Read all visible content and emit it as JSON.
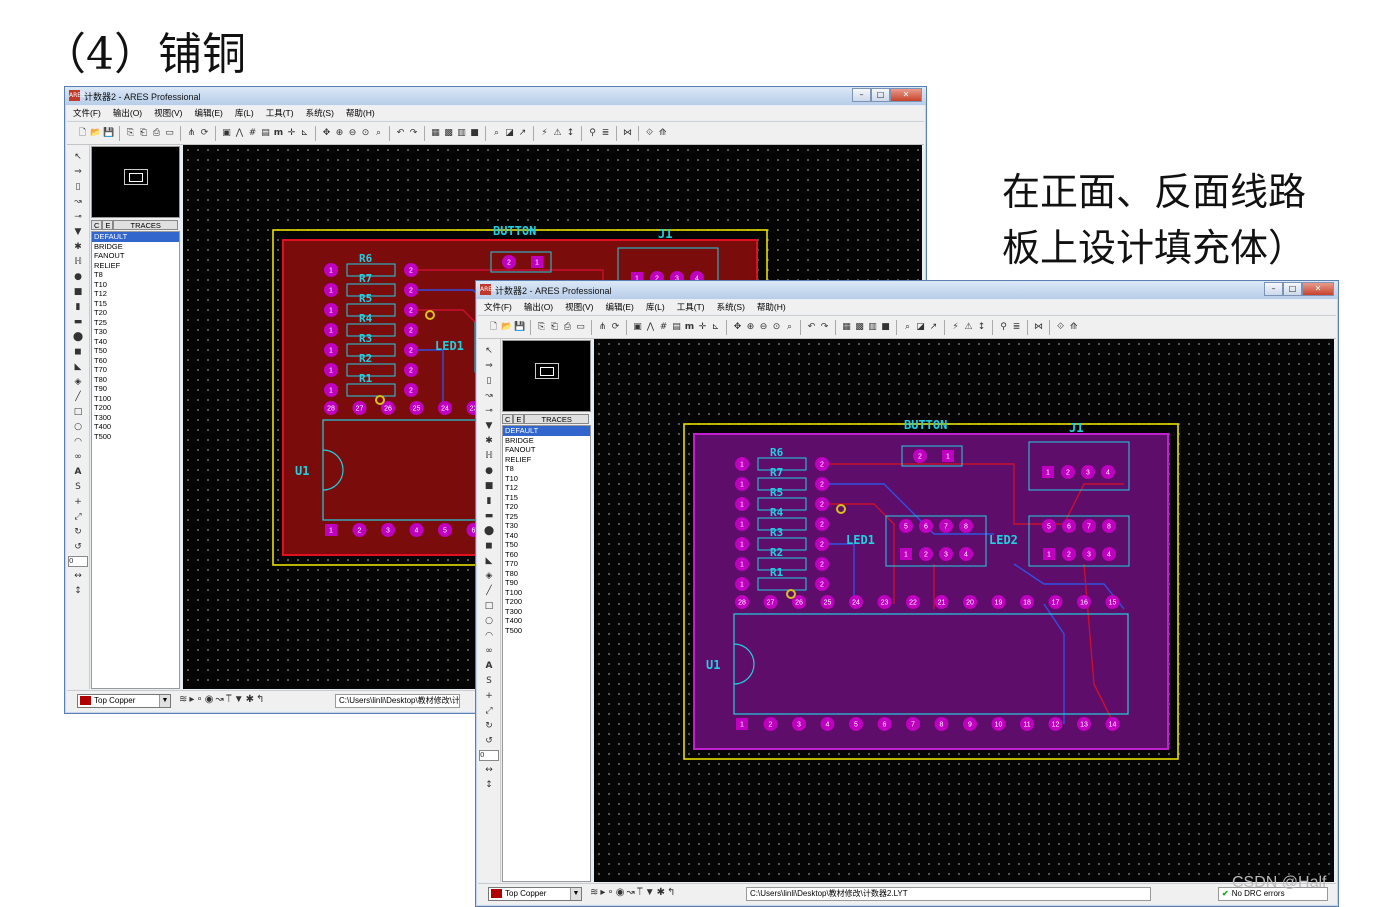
{
  "slide": {
    "heading": "（4）铺铜",
    "caption_line1": "在正面、反面线路",
    "caption_line2": "板上设计填充体）",
    "watermark": "CSDN @Half"
  },
  "window": {
    "title": "计数器2 - ARES Professional",
    "logo": "ARES",
    "controls": {
      "minimize": "–",
      "maximize": "□",
      "close": "✕"
    },
    "menu": [
      "文件(F)",
      "输出(O)",
      "视图(V)",
      "编辑(E)",
      "库(L)",
      "工具(T)",
      "系统(S)",
      "帮助(H)"
    ],
    "panel_tabs": {
      "c": "C",
      "e": "E",
      "traces": "TRACES"
    },
    "trace_styles": [
      "DEFAULT",
      "BRIDGE",
      "FANOUT",
      "RELIEF",
      "T8",
      "T10",
      "T12",
      "T15",
      "T20",
      "T25",
      "T30",
      "T40",
      "T50",
      "T60",
      "T70",
      "T80",
      "T90",
      "T100",
      "T200",
      "T300",
      "T400",
      "T500"
    ],
    "selected_style": "DEFAULT",
    "rotation_value": "0",
    "layer": "Top Copper",
    "file_path": "C:\\Users\\linli\\Desktop\\教材修改\\计数器2.LYT",
    "file_path_truncated": "C:\\Users\\linli\\Desktop\\教材修改\\计",
    "drc": "No DRC errors",
    "drc_icon": "check-icon"
  },
  "pcb": {
    "labels": {
      "button": "BUTTON",
      "j1": "J1",
      "led1": "LED1",
      "led2": "LED2",
      "u1": "U1"
    },
    "resistors": [
      "R6",
      "R7",
      "R5",
      "R4",
      "R3",
      "R2",
      "R1"
    ],
    "front_fill_color": "#7a0c0c",
    "back_fill_color": "#5e0e6a",
    "board_outline_color": "#e8e000",
    "top_copper_color": "#c8102e",
    "bottom_copper_color": "#3050e0",
    "silk_color": "#20d0e0",
    "pad_color": "#c000c0",
    "chip_pins_top": [
      "28",
      "27",
      "26",
      "25",
      "24",
      "23",
      "22",
      "21",
      "20",
      "19",
      "18",
      "17",
      "16",
      "15"
    ],
    "chip_pins_bottom": [
      "1",
      "2",
      "3",
      "4",
      "5",
      "6",
      "7",
      "8",
      "9",
      "10",
      "11",
      "12",
      "13",
      "14"
    ],
    "header_pins": [
      "1",
      "2",
      "3",
      "4"
    ],
    "led_pins_top": [
      "5",
      "6",
      "7",
      "8"
    ],
    "led_pins_bottom": [
      "1",
      "2",
      "3",
      "4"
    ],
    "button_pins": [
      "2",
      "1"
    ]
  }
}
